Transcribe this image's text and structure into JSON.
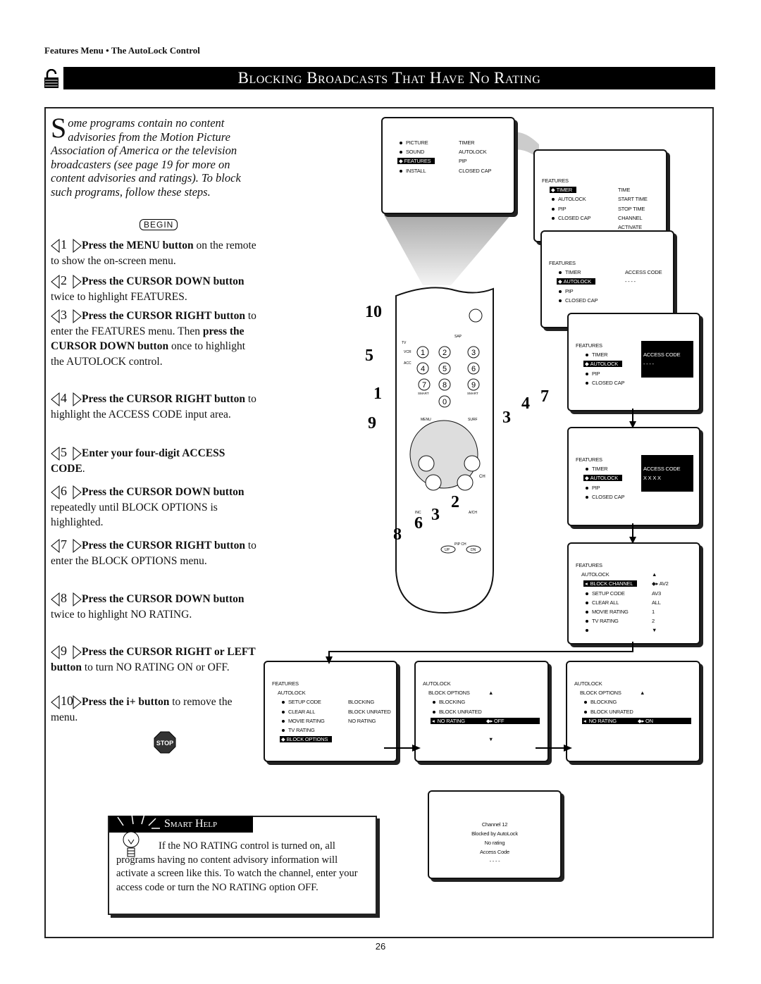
{
  "header": {
    "section": "Features Menu • The AutoLock Control",
    "title": "Blocking Broadcasts That Have No Rating"
  },
  "intro": {
    "dropcap": "S",
    "text": "ome programs contain no content advisories from the Motion Picture Association of America or the television broadcasters (see page 19 for more on content advisories and ratings). To block such programs, follow these steps.",
    "begin": "BEGIN"
  },
  "steps": [
    {
      "n": "1",
      "parts": [
        {
          "t": "Press the MENU button",
          "b": true
        },
        {
          "t": " on the remote to show the on-screen menu.",
          "b": false
        }
      ]
    },
    {
      "n": "2",
      "parts": [
        {
          "t": "Press the CURSOR DOWN button",
          "b": true
        },
        {
          "t": " twice to highlight FEATURES.",
          "b": false
        }
      ]
    },
    {
      "n": "3",
      "parts": [
        {
          "t": "Press the CURSOR RIGHT button",
          "b": true
        },
        {
          "t": " to enter the FEATURES menu. Then ",
          "b": false
        },
        {
          "t": "press the CURSOR DOWN button",
          "b": true
        },
        {
          "t": " once to highlight the AUTOLOCK control.",
          "b": false
        }
      ]
    },
    {
      "n": "4",
      "parts": [
        {
          "t": "Press the CURSOR RIGHT button",
          "b": true
        },
        {
          "t": " to highlight the ACCESS CODE input area.",
          "b": false
        }
      ]
    },
    {
      "n": "5",
      "parts": [
        {
          "t": "Enter your four-digit ACCESS CODE",
          "b": true
        },
        {
          "t": ".",
          "b": false
        }
      ]
    },
    {
      "n": "6",
      "parts": [
        {
          "t": "Press the CURSOR DOWN button",
          "b": true
        },
        {
          "t": " repeatedly until BLOCK OPTIONS is highlighted.",
          "b": false
        }
      ]
    },
    {
      "n": "7",
      "parts": [
        {
          "t": "Press the CURSOR RIGHT button",
          "b": true
        },
        {
          "t": " to enter the BLOCK OPTIONS menu.",
          "b": false
        }
      ]
    },
    {
      "n": "8",
      "parts": [
        {
          "t": "Press the CURSOR DOWN button",
          "b": true
        },
        {
          "t": " twice to highlight NO RATING.",
          "b": false
        }
      ]
    },
    {
      "n": "9",
      "parts": [
        {
          "t": "Press the CURSOR RIGHT or LEFT button",
          "b": true
        },
        {
          "t": " to turn NO RATING ON or OFF.",
          "b": false
        }
      ]
    },
    {
      "n": "10",
      "parts": [
        {
          "t": "Press the i+ button",
          "b": true
        },
        {
          "t": " to remove the menu.",
          "b": false
        }
      ]
    }
  ],
  "stop": "STOP",
  "remote": {
    "callouts": [
      "10",
      "5",
      "1",
      "9",
      "3",
      "4",
      "7",
      "2",
      "3",
      "6",
      "8"
    ],
    "labels": [
      "TV",
      "VCR",
      "ACC",
      "SMART",
      "SMART",
      "MENU",
      "SURF",
      "CH",
      "INC",
      "A/CH",
      "PIP CH",
      "UP",
      "DN",
      "SAP"
    ],
    "digits": [
      "1",
      "2",
      "3",
      "4",
      "5",
      "6",
      "7",
      "8",
      "9",
      "0"
    ]
  },
  "screens": [
    {
      "id": "main-menu",
      "lines": [
        [
          "dot",
          "PICTURE",
          "TIMER"
        ],
        [
          "dot",
          "SOUND",
          "AUTOLOCK"
        ],
        [
          "sel",
          "FEATURES",
          "PIP"
        ],
        [
          "dot",
          "INSTALL",
          "CLOSED CAP"
        ]
      ]
    },
    {
      "id": "features-timer",
      "lines": [
        [
          "title",
          "FEATURES",
          ""
        ],
        [
          "sel",
          "TIMER",
          "TIME"
        ],
        [
          "dot",
          "AUTOLOCK",
          "START TIME"
        ],
        [
          "dot",
          "PIP",
          "STOP TIME"
        ],
        [
          "dot",
          "CLOSED CAP",
          "CHANNEL"
        ],
        [
          "none",
          "",
          "ACTIVATE"
        ]
      ]
    },
    {
      "id": "features-autolock",
      "lines": [
        [
          "title",
          "FEATURES",
          ""
        ],
        [
          "dot",
          "TIMER",
          "ACCESS CODE"
        ],
        [
          "sel",
          "AUTOLOCK",
          "- - - -"
        ],
        [
          "dot",
          "PIP",
          ""
        ],
        [
          "dot",
          "CLOSED CAP",
          ""
        ]
      ]
    },
    {
      "id": "access-code-entry",
      "lines": [
        [
          "title",
          "FEATURES",
          ""
        ],
        [
          "dot",
          "TIMER",
          "ACCESS CODE"
        ],
        [
          "sel2",
          "AUTOLOCK",
          "- - - -"
        ],
        [
          "dot",
          "PIP",
          ""
        ],
        [
          "dot",
          "CLOSED CAP",
          ""
        ]
      ]
    },
    {
      "id": "access-code-entered",
      "lines": [
        [
          "title",
          "FEATURES",
          ""
        ],
        [
          "dot",
          "TIMER",
          "ACCESS CODE"
        ],
        [
          "sel2",
          "AUTOLOCK",
          "X X X X"
        ],
        [
          "dot",
          "PIP",
          ""
        ],
        [
          "dot",
          "CLOSED CAP",
          ""
        ]
      ]
    },
    {
      "id": "autolock-menu",
      "lines": [
        [
          "title",
          "FEATURES",
          ""
        ],
        [
          "sub",
          "AUTOLOCK",
          "▲"
        ],
        [
          "left",
          "BLOCK CHANNEL",
          "AV2"
        ],
        [
          "dot",
          "SETUP CODE",
          "AV3"
        ],
        [
          "dot",
          "CLEAR ALL",
          "ALL"
        ],
        [
          "dot",
          "MOVIE RATING",
          "1"
        ],
        [
          "dot",
          "TV RATING",
          "2"
        ],
        [
          "dot",
          "",
          "▼"
        ]
      ]
    },
    {
      "id": "block-options-select",
      "lines": [
        [
          "title",
          "FEATURES",
          ""
        ],
        [
          "sub",
          "AUTOLOCK",
          ""
        ],
        [
          "dot",
          "SETUP CODE",
          "BLOCKING"
        ],
        [
          "dot",
          "CLEAR ALL",
          "BLOCK UNRATED"
        ],
        [
          "dot",
          "MOVIE RATING",
          "NO RATING"
        ],
        [
          "dot",
          "TV RATING",
          ""
        ],
        [
          "sel",
          "BLOCK OPTIONS",
          ""
        ]
      ]
    },
    {
      "id": "no-rating-off",
      "lines": [
        [
          "title",
          "AUTOLOCK",
          ""
        ],
        [
          "sub",
          "BLOCK OPTIONS",
          "▲"
        ],
        [
          "dot",
          "BLOCKING",
          ""
        ],
        [
          "dot",
          "BLOCK UNRATED",
          ""
        ],
        [
          "left",
          "NO RATING",
          "OFF"
        ],
        [
          "none",
          "",
          ""
        ],
        [
          "none",
          "",
          "▼"
        ]
      ]
    },
    {
      "id": "no-rating-on",
      "lines": [
        [
          "title",
          "AUTOLOCK",
          ""
        ],
        [
          "sub",
          "BLOCK OPTIONS",
          "▲"
        ],
        [
          "dot",
          "BLOCKING",
          ""
        ],
        [
          "dot",
          "BLOCK UNRATED",
          ""
        ],
        [
          "left",
          "NO RATING",
          "ON"
        ]
      ]
    }
  ],
  "blocked_screen": [
    "Channel 12",
    "Blocked by AutoLock",
    "No rating",
    "Access Code",
    "- - - -"
  ],
  "smart_help": {
    "title": "Smart Help",
    "text": "If the NO RATING control is turned on, all programs having no content advisory information will activate a screen like this. To watch the channel, enter your access code or turn the NO RATING option OFF."
  },
  "page_number": "26"
}
